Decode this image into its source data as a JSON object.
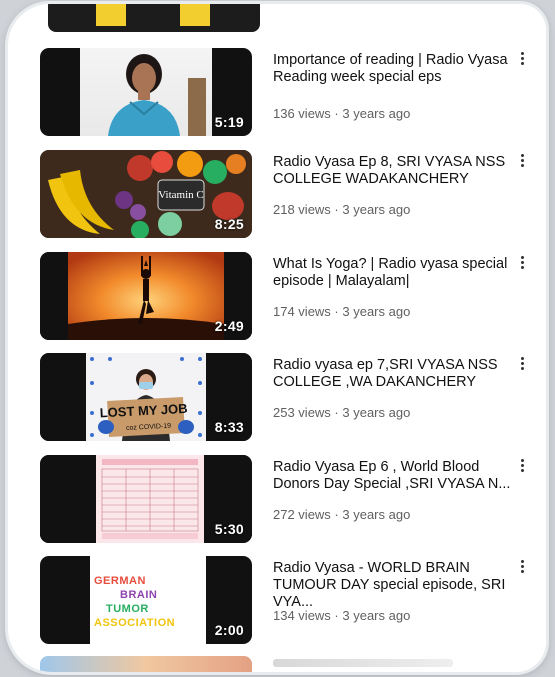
{
  "videos": [
    {
      "title": "Importance of reading | Radio Vyasa Reading week special eps",
      "views": "136 views",
      "age": "3 years ago",
      "duration": "5:19"
    },
    {
      "title": "Radio Vyasa Ep 8, SRI VYASA NSS COLLEGE WADAKANCHERY",
      "views": "218 views",
      "age": "3 years ago",
      "duration": "8:25",
      "thumb_label": "Vitamin C"
    },
    {
      "title": "What Is Yoga? | Radio vyasa special episode | Malayalam|",
      "views": "174 views",
      "age": "3 years ago",
      "duration": "2:49"
    },
    {
      "title": "Radio vyasa  ep 7,SRI VYASA NSS COLLEGE ,WA DAKANCHERY",
      "views": "253 views",
      "age": "3 years ago",
      "duration": "8:33",
      "thumb_label": "LOST MY JOB",
      "thumb_sub": "coz COVID-19"
    },
    {
      "title": "Radio Vyasa Ep 6 , World Blood Donors Day Special ,SRI VYASA N...",
      "views": "272 views",
      "age": "3 years ago",
      "duration": "5:30"
    },
    {
      "title": "Radio Vyasa - WORLD BRAIN TUMOUR DAY special episode, SRI VYA...",
      "views": "134 views",
      "age": "3 years ago",
      "duration": "2:00",
      "thumb_lines": [
        "GERMAN",
        "BRAIN",
        "TUMOR",
        "ASSOCIATION"
      ]
    }
  ],
  "meta_separator": " · "
}
